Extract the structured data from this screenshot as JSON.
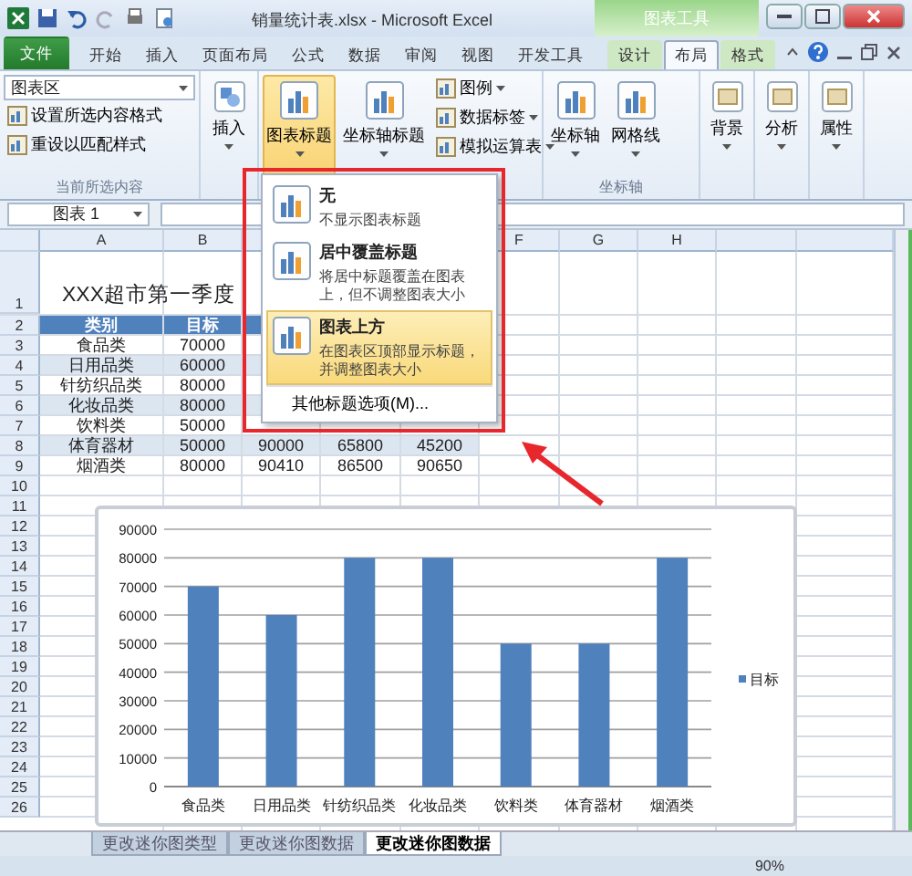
{
  "title_bar": {
    "title": "销量统计表.xlsx - Microsoft Excel",
    "context_tab": "图表工具"
  },
  "ribbon_tabs": [
    {
      "label": "文件",
      "kind": "file",
      "selected": false
    },
    {
      "label": "开始",
      "kind": "plain",
      "selected": false
    },
    {
      "label": "插入",
      "kind": "plain",
      "selected": false
    },
    {
      "label": "页面布局",
      "kind": "plain",
      "selected": false
    },
    {
      "label": "公式",
      "kind": "plain",
      "selected": false
    },
    {
      "label": "数据",
      "kind": "plain",
      "selected": false
    },
    {
      "label": "审阅",
      "kind": "plain",
      "selected": false
    },
    {
      "label": "视图",
      "kind": "plain",
      "selected": false
    },
    {
      "label": "开发工具",
      "kind": "plain",
      "selected": false
    },
    {
      "label": "设计",
      "kind": "context",
      "selected": false
    },
    {
      "label": "布局",
      "kind": "context",
      "selected": true
    },
    {
      "label": "格式",
      "kind": "context",
      "selected": false
    }
  ],
  "ribbon": {
    "current_selection": {
      "dropdown": "图表区",
      "commands": [
        "设置所选内容格式",
        "重设以匹配样式"
      ],
      "label": "当前所选内容"
    },
    "insert": {
      "label": "插入"
    },
    "labels": {
      "large": [
        {
          "label": "图表标题",
          "selected": true
        },
        {
          "label": "坐标轴标题",
          "selected": false
        }
      ],
      "small": [
        "图例",
        "数据标签",
        "模拟运算表"
      ]
    },
    "axes": {
      "buttons": [
        "坐标轴",
        "网格线"
      ],
      "label": "坐标轴"
    },
    "others": [
      "背景",
      "分析",
      "属性"
    ]
  },
  "name_box": "图表 1",
  "sheet": {
    "columns": [
      {
        "label": "A"
      },
      {
        "label": "B"
      },
      {},
      {},
      {},
      {
        "label": "F"
      },
      {
        "label": "G"
      },
      {
        "label": "H"
      },
      {},
      {}
    ],
    "title_row": {
      "number": "1",
      "text": "XXX超市第一季度"
    },
    "rows": [
      {
        "number": "2",
        "kind": "header",
        "cells": [
          "类别",
          "目标"
        ]
      },
      {
        "number": "3",
        "kind": "data",
        "cells": [
          "食品类",
          "70000"
        ]
      },
      {
        "number": "4",
        "kind": "data",
        "cells": [
          "日用品类",
          "60000"
        ]
      },
      {
        "number": "5",
        "kind": "data",
        "cells": [
          "针纺织品类",
          "80000"
        ]
      },
      {
        "number": "6",
        "kind": "data",
        "cells": [
          "化妆品类",
          "80000"
        ]
      },
      {
        "number": "7",
        "kind": "data",
        "cells": [
          "饮料类",
          "50000"
        ]
      },
      {
        "number": "8",
        "kind": "data",
        "cells": [
          "体育器材",
          "50000",
          "90000",
          "65800",
          "45200"
        ]
      },
      {
        "number": "9",
        "kind": "data",
        "cells": [
          "烟酒类",
          "80000",
          "90410",
          "86500",
          "90650"
        ]
      },
      {
        "number": "10",
        "kind": "empty",
        "cells": []
      }
    ],
    "empty_rows": [
      "11",
      "12",
      "13",
      "14",
      "15",
      "16",
      "17",
      "18",
      "19",
      "20",
      "21",
      "22",
      "23",
      "24",
      "25",
      "26"
    ]
  },
  "chart": {
    "chart_data": {
      "type": "bar",
      "categories": [
        "食品类",
        "日用品类",
        "针纺织品类",
        "化妆品类",
        "饮料类",
        "体育器材",
        "烟酒类"
      ],
      "series": [
        {
          "name": "目标",
          "color": "#4f81bd",
          "values": [
            70000,
            60000,
            80000,
            80000,
            50000,
            50000,
            80000
          ]
        }
      ],
      "grid": true,
      "ylim": [
        0,
        90000
      ],
      "yticks": [
        0,
        10000,
        20000,
        30000,
        40000,
        50000,
        60000,
        70000,
        80000,
        90000
      ]
    }
  },
  "menu": {
    "items": [
      {
        "title": "无",
        "description": "不显示图表标题",
        "selected": false
      },
      {
        "title": "居中覆盖标题",
        "description": "将居中标题覆盖在图表上，但不调整图表大小",
        "selected": false
      },
      {
        "title": "图表上方",
        "description": "在图表区顶部显示标题，并调整图表大小",
        "selected": true
      }
    ],
    "footer": "其他标题选项(M)..."
  },
  "sheet_tabs": [
    {
      "label": "更改迷你图类型",
      "selected": false
    },
    {
      "label": "更改迷你图数据",
      "selected": false
    },
    {
      "label": "更改迷你图数据",
      "selected": true
    }
  ],
  "status_bar": {
    "zoom": "90%"
  }
}
